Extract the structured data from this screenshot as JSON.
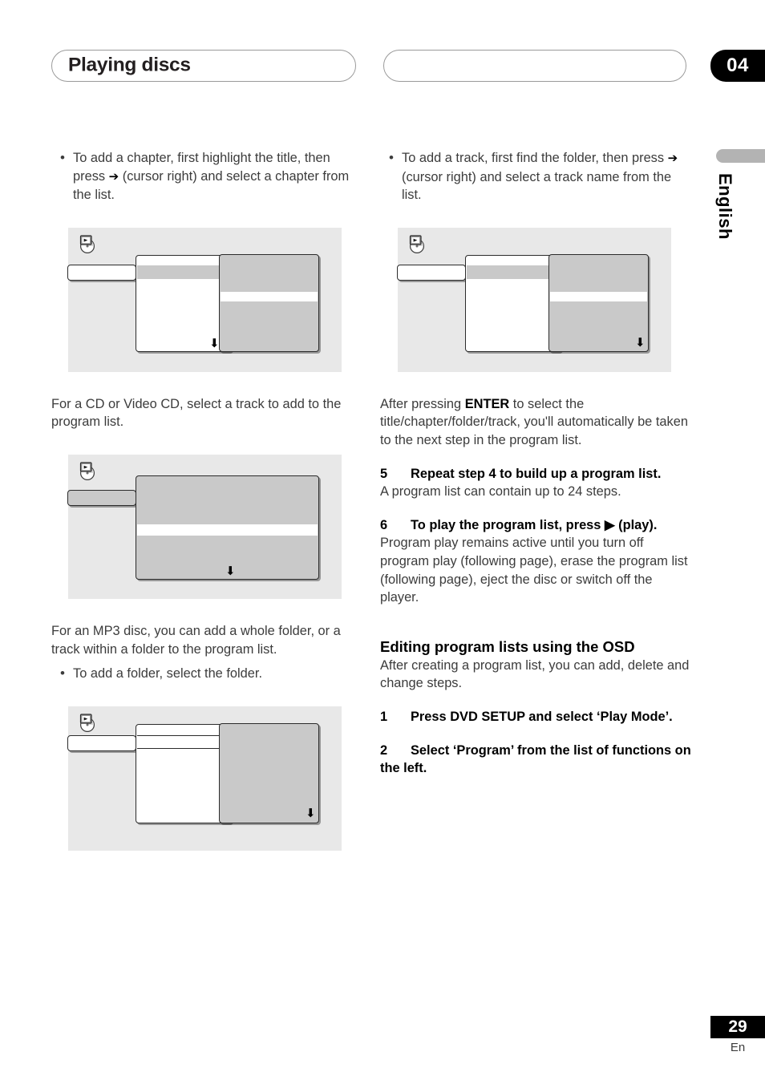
{
  "header": {
    "chapter_title": "Playing discs",
    "chapter_number": "04"
  },
  "side_tab": {
    "language_label": "English"
  },
  "footer": {
    "page_number": "29",
    "language_code": "En"
  },
  "left_column": {
    "bullet_1": "To add a chapter, first highlight the title, then press ➔ (cursor right) and select a chapter from the list.",
    "bullet_1_parts": {
      "before": "To add a chapter, first highlight the title, then press ",
      "arrow": "➔",
      "after": " (cursor right) and select a chapter from the list."
    },
    "figure_1_name": "osd-title-chapter-list",
    "para_1": "For a CD or Video CD, select a track to add to the program list.",
    "figure_2_name": "osd-cd-track-list",
    "para_2": "For an MP3 disc, you can add a whole folder, or a track within a folder to the program list.",
    "bullet_2": "To add a folder, select the folder.",
    "figure_3_name": "osd-mp3-folder-list"
  },
  "right_column": {
    "bullet_1_parts": {
      "before": "To add a track, first find the folder, then press ",
      "arrow": "➔",
      "after": " (cursor right) and select a track name from the list."
    },
    "figure_1_name": "osd-mp3-track-list",
    "para_1_parts": {
      "before": "After pressing ",
      "bold": "ENTER",
      "after": " to select the title/chapter/folder/track, you'll automatically be taken to the next step in the program list."
    },
    "step_5": {
      "number": "5",
      "heading": "Repeat step 4 to build up a program list.",
      "body": "A program list can contain up to 24 steps."
    },
    "step_6": {
      "number": "6",
      "heading_before": "To play the program list, press ",
      "heading_icon": "▶",
      "heading_after": " (play).",
      "body": "Program play remains active until you turn off program play (following page), erase the program list (following page), eject the disc or switch off the player."
    },
    "section": {
      "heading": "Editing program lists using the OSD",
      "body": "After creating a program list, you can add, delete and change steps."
    },
    "step_1": {
      "number": "1",
      "heading": "Press DVD SETUP and select ‘Play Mode’."
    },
    "step_2": {
      "number": "2",
      "heading": "Select ‘Program’ from the list of functions on the left."
    }
  },
  "colors": {
    "osd_background": "#e8e8e8",
    "osd_panel_grey": "#c9c9c9",
    "badge_black": "#000000",
    "side_tab_grey": "#b3b3b3"
  }
}
